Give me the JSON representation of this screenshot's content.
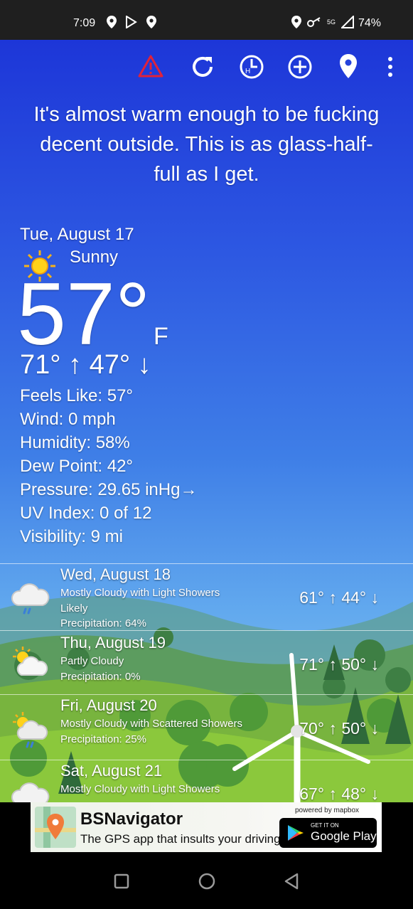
{
  "status_bar": {
    "time": "7:09",
    "battery": "74%",
    "network": "5G"
  },
  "toolbar": {
    "icons": [
      "alert-icon",
      "refresh-icon",
      "history-icon",
      "add-location-icon",
      "location-pin-icon",
      "overflow-menu-icon"
    ]
  },
  "headline": "It's almost warm enough to be fucking decent outside. This is as glass-half-full as I get.",
  "current": {
    "date": "Tue, August 17",
    "condition": "Sunny",
    "temp": "57°",
    "unit": "F",
    "hilo": "71° ↑  47° ↓",
    "details": [
      "Feels Like:  57°",
      "Wind:   0 mph",
      "Humidity:  58%",
      "Dew Point:  42°",
      "Pressure:  29.65 inHg→",
      "UV Index:  0 of 12",
      "Visibility:  9 mi"
    ]
  },
  "forecast": [
    {
      "day": "Wed, August 18",
      "desc": "Mostly Cloudy with Light Showers",
      "desc2": "Likely",
      "precip": "Precipitation:  64%",
      "hilo": "61° ↑  44° ↓"
    },
    {
      "day": "Thu, August 19",
      "desc": "Partly Cloudy",
      "desc2": "",
      "precip": "Precipitation:  0%",
      "hilo": "71° ↑  50° ↓"
    },
    {
      "day": "Fri, August 20",
      "desc": "Mostly Cloudy with Scattered Showers",
      "desc2": "",
      "precip": "Precipitation:  25%",
      "hilo": "70° ↑  50° ↓"
    },
    {
      "day": "Sat, August 21",
      "desc": "Mostly Cloudy with Light Showers",
      "desc2": "",
      "precip": "",
      "hilo": "67° ↑  48° ↓"
    }
  ],
  "ad": {
    "title": "BSNavigator",
    "subtitle": "The GPS app that insults your driving.",
    "powered": "powered by mapbox",
    "store_small": "GET IT ON",
    "store_big": "Google Play"
  },
  "colors": {
    "alert": "#e0223a",
    "sky_top": "#1d36d8",
    "sky_bottom": "#8fcdf5"
  }
}
